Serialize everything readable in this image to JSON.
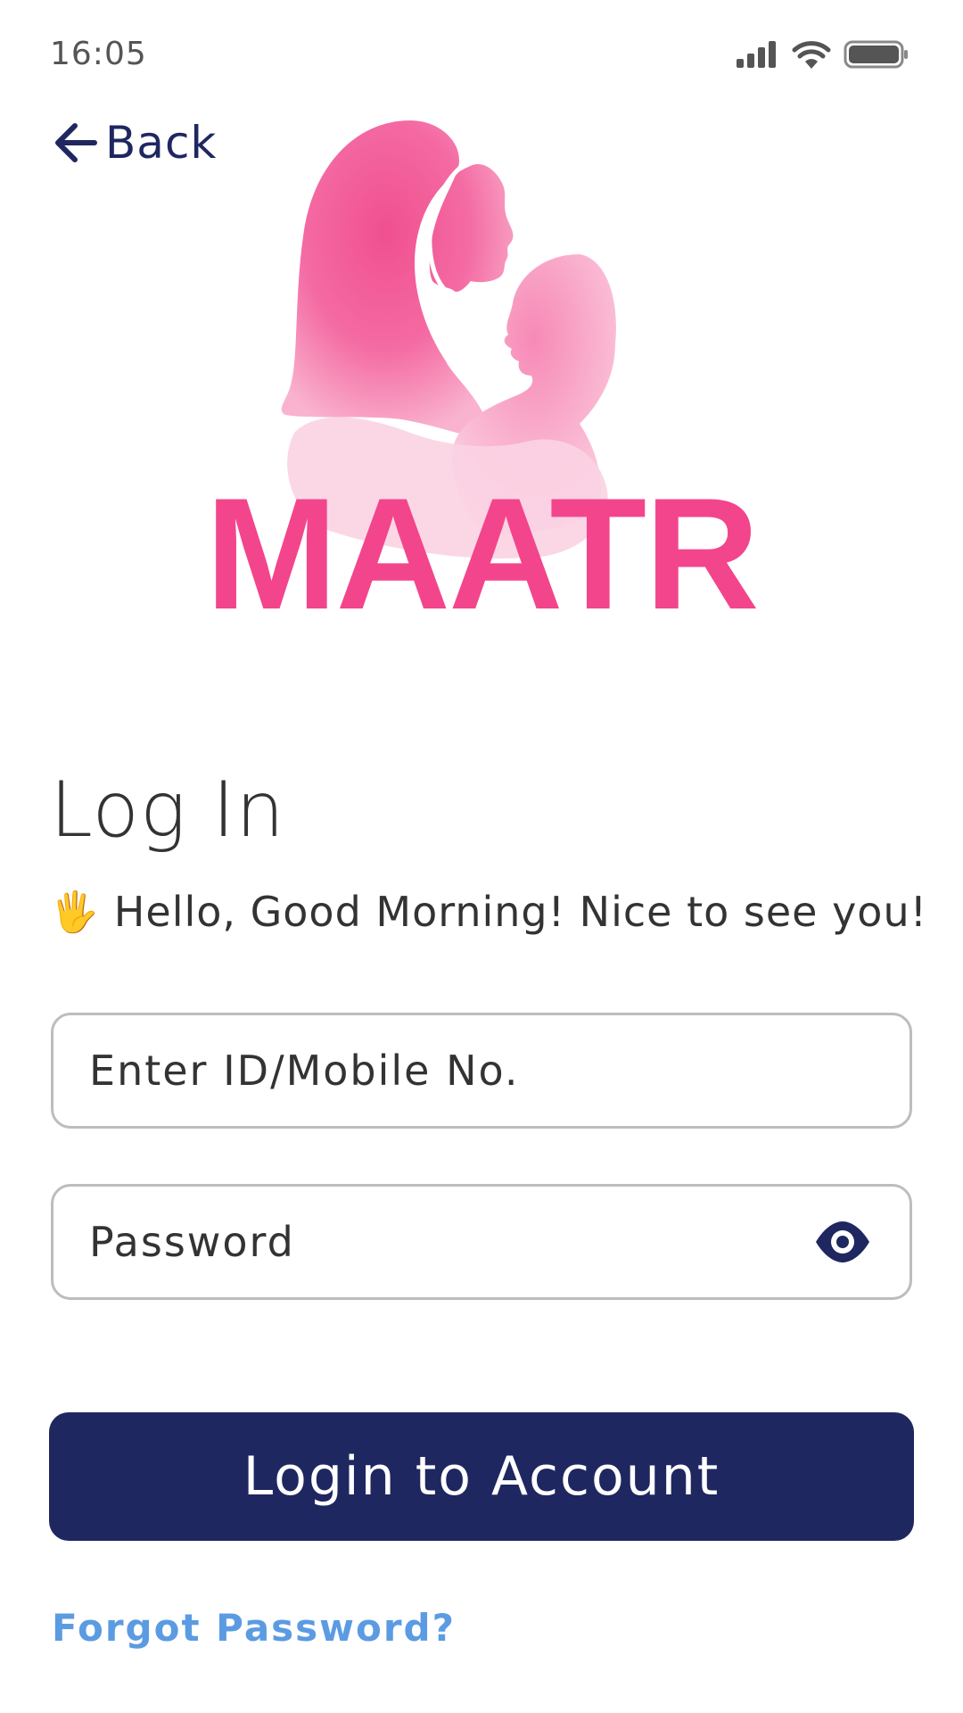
{
  "status_bar": {
    "time": "16:05",
    "icons": [
      "signal-icon",
      "wifi-icon",
      "battery-icon"
    ]
  },
  "header": {
    "back_label": "Back",
    "back_icon": "arrow-left-icon"
  },
  "brand": {
    "name": "MAATR",
    "logo": "mother-and-baby-logo",
    "color": "#f3458b"
  },
  "login": {
    "title": "Log In",
    "greeting_emoji": "🖐",
    "greeting": "Hello, Good Morning! Nice to see you!",
    "id_field": {
      "placeholder": "Enter ID/Mobile No.",
      "value": ""
    },
    "password_field": {
      "placeholder": "Password",
      "value": "",
      "toggle_icon": "eye-icon"
    },
    "submit_label": "Login to Account",
    "forgot_label": "Forgot Password?"
  },
  "colors": {
    "primary": "#1f2761",
    "link": "#5b9be2",
    "border": "#bdbdbd",
    "text": "#333333"
  }
}
